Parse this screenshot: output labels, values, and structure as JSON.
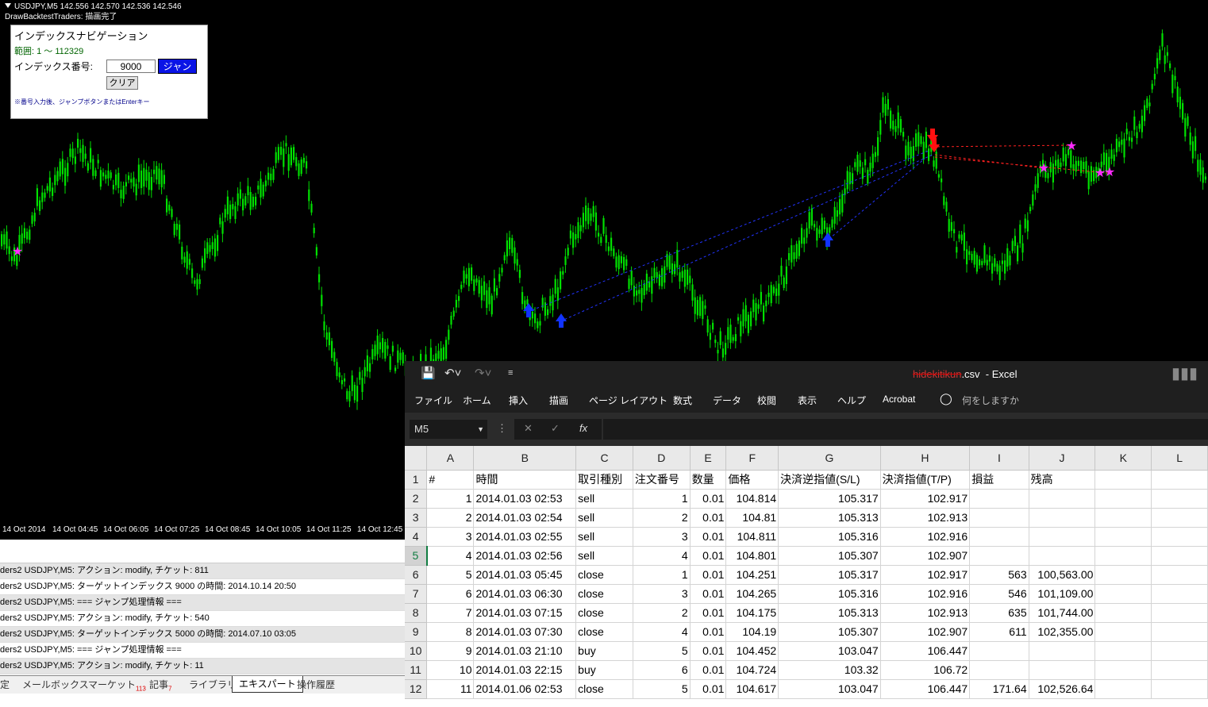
{
  "chart": {
    "symbol_line": "USDJPY,M5  142.556 142.570 142.536 142.546",
    "ea_line": "DrawBacktestTraders: 描画完了",
    "candle_color": "#00e000",
    "time_labels": [
      "14 Oct 2014",
      "14 Oct 04:45",
      "14 Oct 06:05",
      "14 Oct 07:25",
      "14 Oct 08:45",
      "14 Oct 10:05",
      "14 Oct 11:25",
      "14 Oct 12:45"
    ]
  },
  "nav": {
    "title": "インデックスナビゲーション",
    "range": "範囲: 1 ～ 112329",
    "index_label": "インデックス番号:",
    "index_value": "9000",
    "jump_label": "ジャンプ",
    "clear_label": "クリア",
    "hint": "※番号入力後、ジャンプボタンまたはEnterキー"
  },
  "terminal": {
    "logs": [
      "ders2 USDJPY,M5: アクション: modify, チケット: 811",
      "ders2 USDJPY,M5: ターゲットインデックス 9000 の時間: 2014.10.14 20:50",
      "ders2 USDJPY,M5: === ジャンプ処理情報 ===",
      "ders2 USDJPY,M5: アクション: modify, チケット: 540",
      "ders2 USDJPY,M5: ターゲットインデックス 5000 の時間: 2014.07.10 03:05",
      "ders2 USDJPY,M5: === ジャンプ処理情報 ===",
      "ders2 USDJPY,M5: アクション: modify, チケット: 11"
    ],
    "tabs": {
      "t0": "定",
      "t1": "メールボックス",
      "t2": "マーケット",
      "t2_badge": "113",
      "t3": "記事",
      "t3_badge": "7",
      "t4": "ライブラリ",
      "t5": "エキスパート",
      "t6": "操作履歴"
    }
  },
  "excel": {
    "file_strike": "hidekitikun",
    "file_ext": ".csv",
    "app": "-  Excel",
    "ribbon": [
      "ファイル",
      "ホーム",
      "挿入",
      "描画",
      "ページ レイアウト",
      "数式",
      "データ",
      "校閲",
      "表示",
      "ヘルプ",
      "Acrobat"
    ],
    "tell_me": "何をしますか",
    "name_box": "M5",
    "columns": [
      "A",
      "B",
      "C",
      "D",
      "E",
      "F",
      "G",
      "H",
      "I",
      "J",
      "K",
      "L"
    ],
    "header_row": [
      "#",
      "時間",
      "取引種別",
      "注文番号",
      "数量",
      "価格",
      "決済逆指値(S/L)",
      "決済指値(T/P)",
      "損益",
      "残高",
      "",
      ""
    ],
    "rows": [
      [
        "1",
        "2014.01.03 02:53",
        "sell",
        "1",
        "0.01",
        "104.814",
        "105.317",
        "102.917",
        "",
        "",
        "",
        ""
      ],
      [
        "2",
        "2014.01.03 02:54",
        "sell",
        "2",
        "0.01",
        "104.81",
        "105.313",
        "102.913",
        "",
        "",
        "",
        ""
      ],
      [
        "3",
        "2014.01.03 02:55",
        "sell",
        "3",
        "0.01",
        "104.811",
        "105.316",
        "102.916",
        "",
        "",
        "",
        ""
      ],
      [
        "4",
        "2014.01.03 02:56",
        "sell",
        "4",
        "0.01",
        "104.801",
        "105.307",
        "102.907",
        "",
        "",
        "",
        ""
      ],
      [
        "5",
        "2014.01.03 05:45",
        "close",
        "1",
        "0.01",
        "104.251",
        "105.317",
        "102.917",
        "563",
        "100,563.00",
        "",
        ""
      ],
      [
        "6",
        "2014.01.03 06:30",
        "close",
        "3",
        "0.01",
        "104.265",
        "105.316",
        "102.916",
        "546",
        "101,109.00",
        "",
        ""
      ],
      [
        "7",
        "2014.01.03 07:15",
        "close",
        "2",
        "0.01",
        "104.175",
        "105.313",
        "102.913",
        "635",
        "101,744.00",
        "",
        ""
      ],
      [
        "8",
        "2014.01.03 07:30",
        "close",
        "4",
        "0.01",
        "104.19",
        "105.307",
        "102.907",
        "611",
        "102,355.00",
        "",
        ""
      ],
      [
        "9",
        "2014.01.03 21:10",
        "buy",
        "5",
        "0.01",
        "104.452",
        "103.047",
        "106.447",
        "",
        "",
        "",
        ""
      ],
      [
        "10",
        "2014.01.03 22:15",
        "buy",
        "6",
        "0.01",
        "104.724",
        "103.32",
        "106.72",
        "",
        "",
        "",
        ""
      ],
      [
        "11",
        "2014.01.06 02:53",
        "close",
        "5",
        "0.01",
        "104.617",
        "103.047",
        "106.447",
        "171.64",
        "102,526.64",
        "",
        ""
      ]
    ]
  }
}
